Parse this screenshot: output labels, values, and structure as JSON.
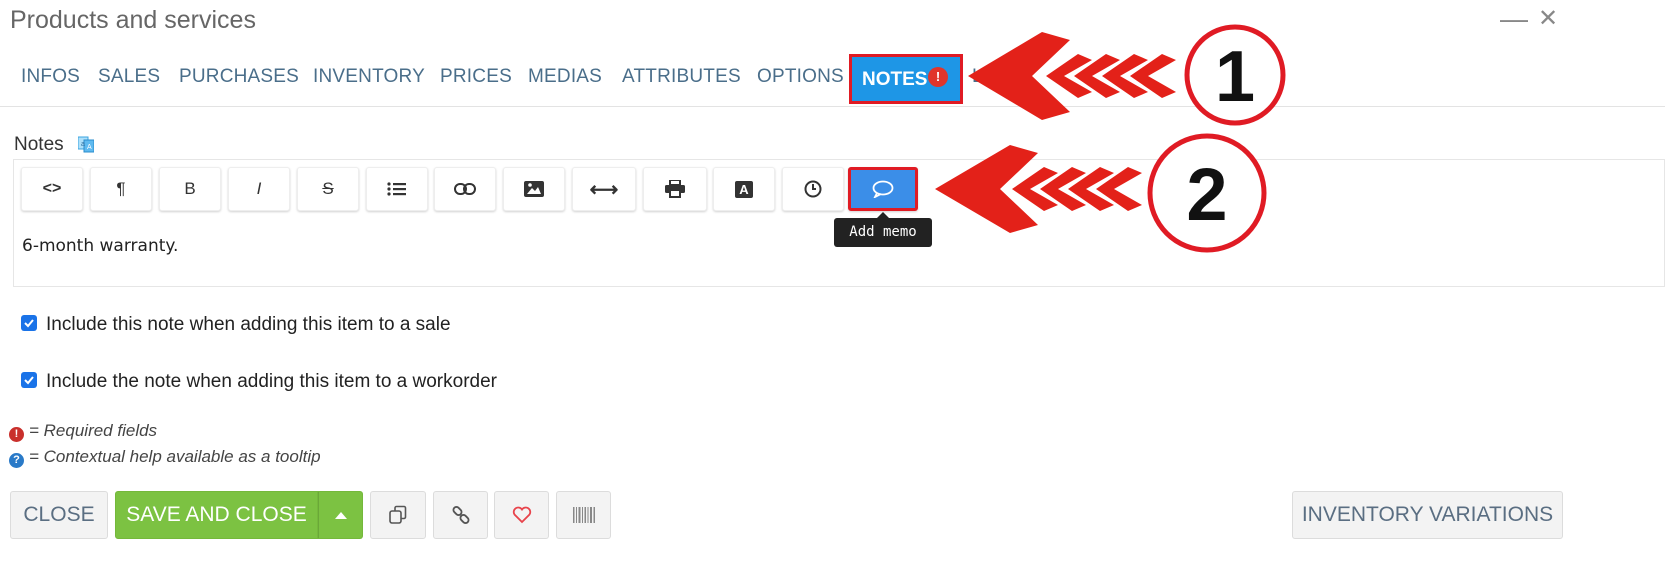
{
  "window": {
    "title": "Products and services",
    "minimize_glyph": "—",
    "close_glyph": "✕"
  },
  "tabs": [
    {
      "label": "INFOS"
    },
    {
      "label": "SALES"
    },
    {
      "label": "PURCHASES"
    },
    {
      "label": "INVENTORY"
    },
    {
      "label": "PRICES"
    },
    {
      "label": "MEDIAS"
    },
    {
      "label": "ATTRIBUTES"
    },
    {
      "label": "OPTIONS"
    }
  ],
  "active_tab": {
    "label": "NOTES",
    "badge": "!"
  },
  "hidden_tab_fragment": "L",
  "notes": {
    "label": "Notes",
    "content": "6-month warranty."
  },
  "toolbar": {
    "tooltip": "Add memo",
    "buttons": [
      {
        "icon": "code-view-icon",
        "glyph": "<>"
      },
      {
        "icon": "paragraph-icon",
        "glyph": "¶"
      },
      {
        "icon": "bold-icon",
        "glyph": "B"
      },
      {
        "icon": "italic-icon",
        "glyph": "I"
      },
      {
        "icon": "strikethrough-icon",
        "glyph": "S"
      },
      {
        "icon": "list-icon",
        "glyph": ""
      },
      {
        "icon": "link-icon",
        "glyph": ""
      },
      {
        "icon": "image-icon",
        "glyph": ""
      },
      {
        "icon": "horizontal-rule-icon",
        "glyph": "⟷"
      },
      {
        "icon": "print-icon",
        "glyph": ""
      },
      {
        "icon": "font-color-icon",
        "glyph": "A"
      },
      {
        "icon": "clock-icon",
        "glyph": ""
      },
      {
        "icon": "memo-icon",
        "glyph": ""
      }
    ]
  },
  "checkboxes": [
    {
      "label": "Include this note when adding this item to a sale",
      "checked": true
    },
    {
      "label": "Include the note when adding this item to a workorder",
      "checked": true
    }
  ],
  "legend": {
    "required": "= Required fields",
    "help": "= Contextual help available as a tooltip"
  },
  "footer": {
    "close_label": "CLOSE",
    "save_label": "SAVE AND CLOSE",
    "inventory_variations_label": "INVENTORY VARIATIONS"
  },
  "annotations": {
    "step1": "1",
    "step2": "2"
  },
  "colors": {
    "accent": "#1e96e6",
    "highlight": "#e01b24",
    "save": "#7cc242",
    "tab_text": "#4a6e8a"
  }
}
